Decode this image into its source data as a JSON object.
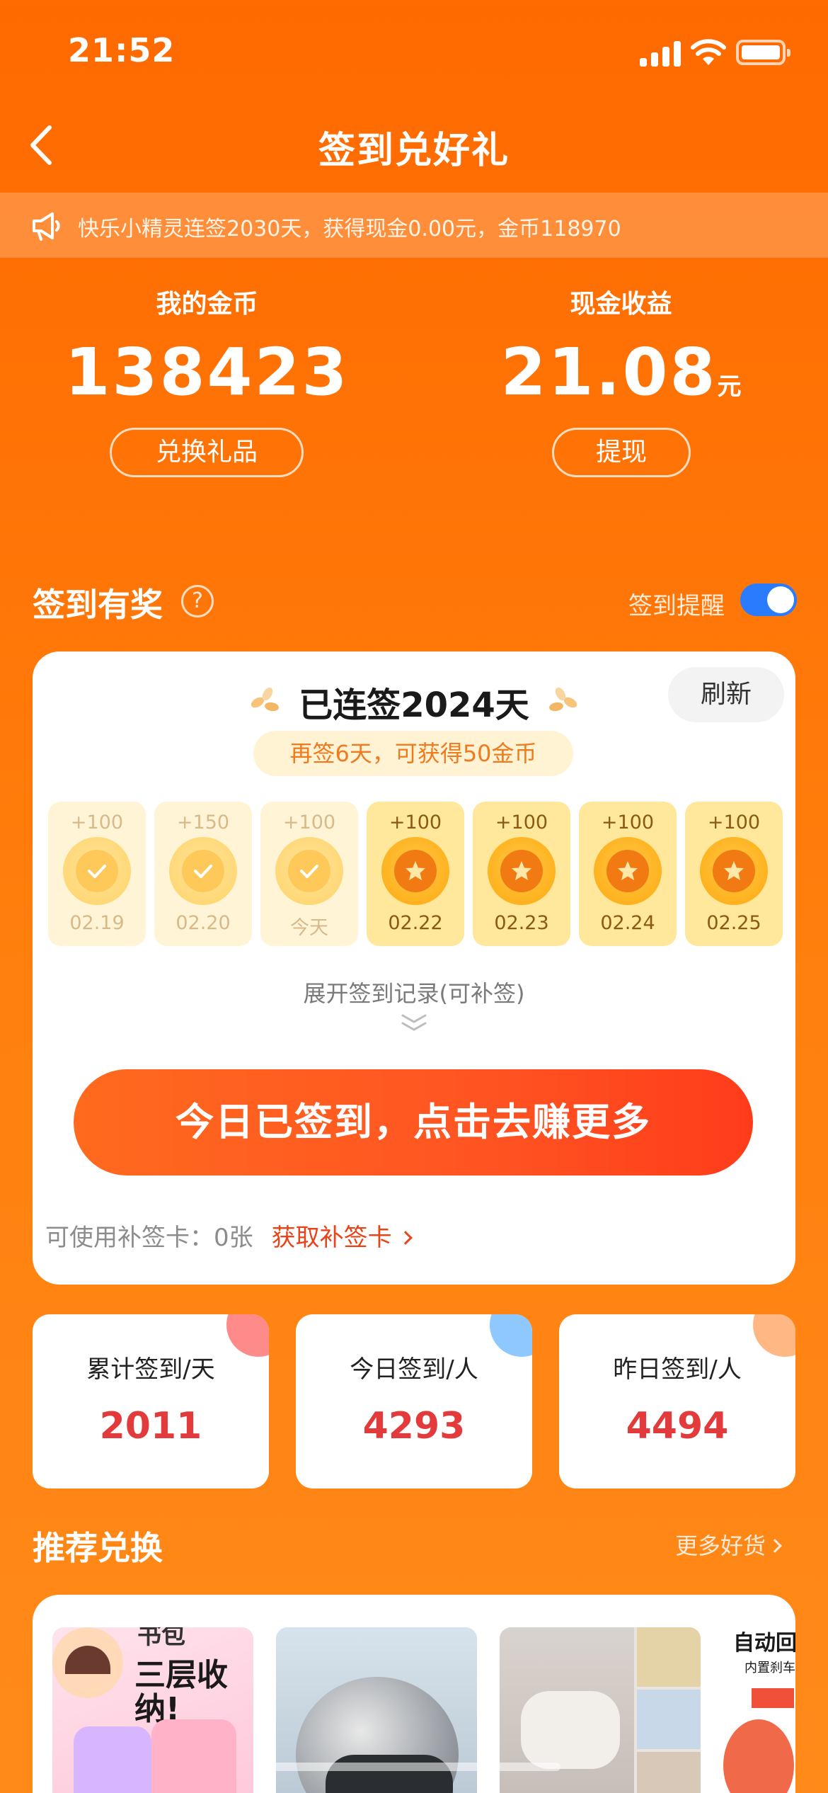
{
  "status_bar": {
    "time": "21:52"
  },
  "nav": {
    "title": "签到兑好礼",
    "back_icon": "chevron-left-icon"
  },
  "notice": {
    "icon": "megaphone-icon",
    "text": "快乐小精灵连签2030天，获得现金0.00元，金币118970"
  },
  "balances": {
    "coins": {
      "label": "我的金币",
      "value": "138423",
      "button": "兑换礼品"
    },
    "cash": {
      "label": "现金收益",
      "value": "21.08",
      "unit": "元",
      "button": "提现"
    }
  },
  "checkin": {
    "section_title": "签到有奖",
    "help_icon": "?",
    "reminder_label": "签到提醒",
    "reminder_on": true,
    "streak_title": "已连签2024天",
    "refresh_label": "刷新",
    "tip": "再签6天，可获得50金币",
    "days": [
      {
        "amount": "+100",
        "date": "02.19",
        "done": true
      },
      {
        "amount": "+150",
        "date": "02.20",
        "done": true
      },
      {
        "amount": "+100",
        "date": "今天",
        "done": true
      },
      {
        "amount": "+100",
        "date": "02.22",
        "done": false
      },
      {
        "amount": "+100",
        "date": "02.23",
        "done": false
      },
      {
        "amount": "+100",
        "date": "02.24",
        "done": false
      },
      {
        "amount": "+100",
        "date": "02.25",
        "done": false
      }
    ],
    "expand_label": "展开签到记录(可补签)",
    "main_button": "今日已签到，点击去赚更多",
    "makeup_label": "可使用补签卡：0张",
    "makeup_link": "获取补签卡"
  },
  "stats": [
    {
      "label": "累计签到/天",
      "value": "2011",
      "deco": "#FF8A8A"
    },
    {
      "label": "今日签到/人",
      "value": "4293",
      "deco": "#8EC8FF"
    },
    {
      "label": "昨日签到/人",
      "value": "4494",
      "deco": "#FFB884"
    }
  ],
  "recommend": {
    "title": "推荐兑换",
    "more_label": "更多好货",
    "products": [
      {
        "caption": "三层收纳!",
        "caption_small": "书包"
      },
      {
        "caption": ""
      },
      {
        "caption": ""
      },
      {
        "caption": "自动回",
        "caption_small": "内置刹车"
      }
    ]
  },
  "colors": {
    "brand_orange": "#FF6A00",
    "accent_red": "#E33B3B",
    "toggle_blue": "#2B7BFF"
  }
}
